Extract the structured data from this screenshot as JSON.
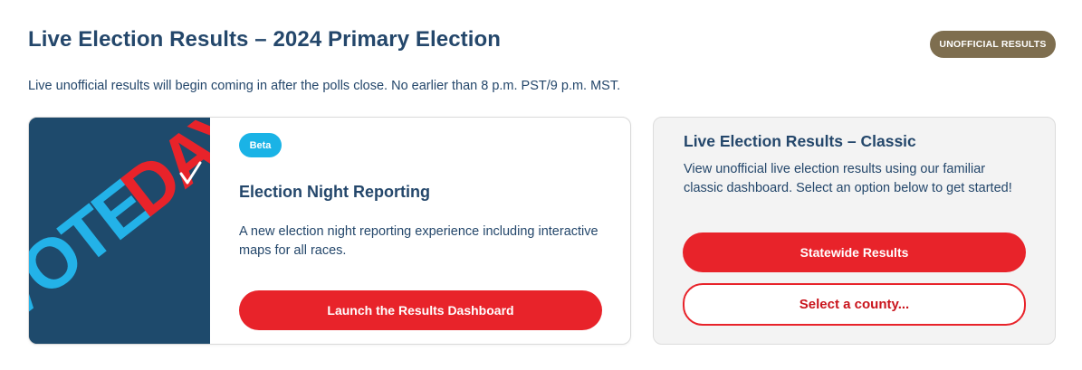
{
  "header": {
    "title": "Live Election Results – 2024 Primary Election",
    "badge": "UNOFFICIAL RESULTS",
    "subtitle": "Live unofficial results will begin coming in after the polls close. No earlier than 8 p.m. PST/9 p.m. MST."
  },
  "enr_card": {
    "image_text": "VOTEDAY",
    "beta_label": "Beta",
    "title": "Election Night Reporting",
    "description": "A new election night reporting experience including interactive maps for all races.",
    "button_label": "Launch the Results Dashboard"
  },
  "classic_card": {
    "title": "Live Election Results – Classic",
    "description": "View unofficial live election results using our familiar classic dashboard. Select an option below to get started!",
    "statewide_label": "Statewide Results",
    "county_select_value": "Select a county..."
  },
  "colors": {
    "accent_red": "#e8232a",
    "title_blue": "#24476b",
    "badge_brown": "#7e6e4f",
    "beta_cyan": "#1ab3e6",
    "image_navy": "#1e4a6c"
  }
}
